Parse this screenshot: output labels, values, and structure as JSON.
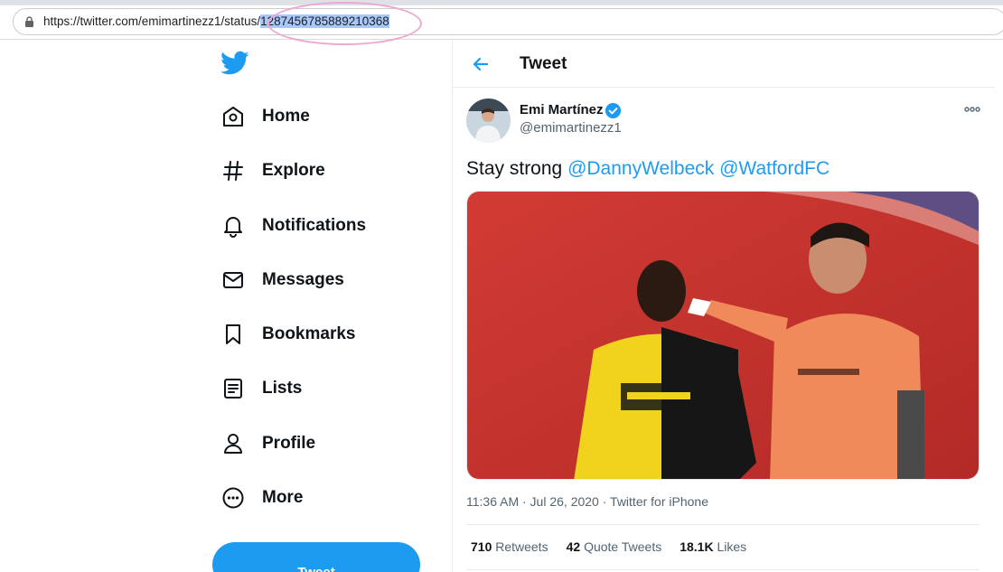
{
  "browser": {
    "url_prefix": "https://twitter.com/emimartinezz1/status/",
    "url_highlight": "1287456785889210368"
  },
  "sidebar": {
    "items": [
      {
        "label": "Home",
        "icon": "home-icon"
      },
      {
        "label": "Explore",
        "icon": "hashtag-icon"
      },
      {
        "label": "Notifications",
        "icon": "bell-icon"
      },
      {
        "label": "Messages",
        "icon": "envelope-icon"
      },
      {
        "label": "Bookmarks",
        "icon": "bookmark-icon"
      },
      {
        "label": "Lists",
        "icon": "list-icon"
      },
      {
        "label": "Profile",
        "icon": "person-icon"
      },
      {
        "label": "More",
        "icon": "more-circle-icon"
      }
    ],
    "tweet_button": "Tweet"
  },
  "header": {
    "title": "Tweet"
  },
  "tweet": {
    "author_name": "Emi Martínez",
    "author_handle": "@emimartinezz1",
    "text_prefix": "Stay strong",
    "mention_1": "@DannyWelbeck",
    "mention_2": "@WatfordFC",
    "timestamp": "11:36 AM · Jul 26, 2020",
    "separator": "·",
    "source": "Twitter for iPhone",
    "retweets_count": "710",
    "retweets_label": "Retweets",
    "quotes_count": "42",
    "quotes_label": "Quote Tweets",
    "likes_count": "18.1K",
    "likes_label": "Likes"
  },
  "colors": {
    "accent": "#1d9bf0",
    "text": "#0f1419",
    "secondary": "#536471",
    "url_highlight": "#a8c7fa",
    "annotation_ring": "#f0a6cf"
  }
}
